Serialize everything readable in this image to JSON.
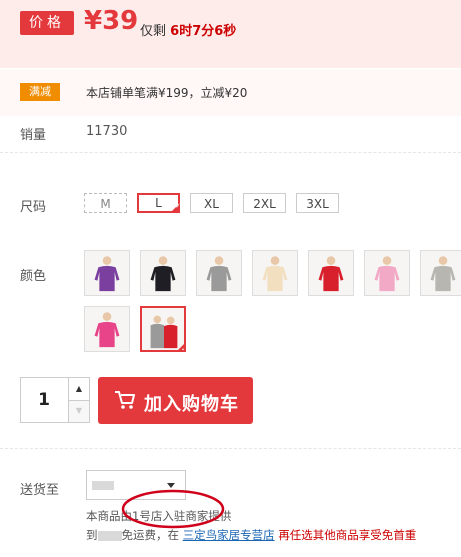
{
  "price": {
    "tag": "价格",
    "value": "¥39",
    "remain_prefix": "仅剩",
    "remain_time": "6时7分6秒"
  },
  "promo": {
    "badge": "满减",
    "text": "本店铺单笔满¥199，立减¥20"
  },
  "sales": {
    "label": "销量",
    "value": "11730"
  },
  "size": {
    "label": "尺码",
    "options": [
      "M",
      "L",
      "XL",
      "2XL",
      "3XL"
    ],
    "selected": "L",
    "unavailable": [
      "M"
    ]
  },
  "color": {
    "label": "颜色",
    "swatches": [
      {
        "name": "purple",
        "color": "#7b3fa0"
      },
      {
        "name": "black",
        "color": "#1e1e24"
      },
      {
        "name": "gray",
        "color": "#9a9a9a"
      },
      {
        "name": "beige",
        "color": "#f1dfc0"
      },
      {
        "name": "red",
        "color": "#d8202c"
      },
      {
        "name": "pink-light",
        "color": "#f2a9c6"
      },
      {
        "name": "gray-light",
        "color": "#b8b6b0"
      },
      {
        "name": "rose",
        "color": "#e8448a"
      },
      {
        "name": "couple",
        "color": "#d8202c",
        "color2": "#9a9a9a"
      }
    ],
    "selected_index": 8
  },
  "quantity": {
    "value": "1",
    "up": "▲",
    "down": "▼"
  },
  "cart": {
    "label": "加入购物车"
  },
  "shipping": {
    "label": "送货至",
    "note1": "本商品由1号店入驻商家提供",
    "note2_prefix": "到",
    "note2_mid": "免运费，在",
    "note2_link": "三定鸟家居专营店",
    "note2_suffix": "再任选其他商品享受免首重"
  },
  "colors": {
    "accent": "#e4393c",
    "promo": "#f08c00",
    "link": "#1a66b3"
  }
}
